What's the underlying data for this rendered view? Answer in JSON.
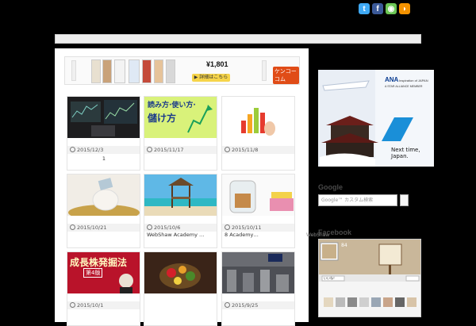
{
  "social": {
    "icons": [
      {
        "name": "twitter-icon",
        "glyph": "t",
        "color": "#3fa9f5"
      },
      {
        "name": "facebook-icon",
        "glyph": "f",
        "color": "#3b5998"
      },
      {
        "name": "feedly-icon",
        "glyph": "◉",
        "color": "#6cc655"
      },
      {
        "name": "rss-icon",
        "glyph": "◗",
        "color": "#f39200"
      }
    ]
  },
  "ad": {
    "price": "¥1,801",
    "button": "▶ 詳細はこちら",
    "logo": "ケンコーコム"
  },
  "posts": [
    {
      "date": "2015/12/3",
      "excerpt": "1"
    },
    {
      "date": "2015/11/17",
      "excerpt": "",
      "thumb_line1": "読み方·使い方·",
      "thumb_line2": "儲け方"
    },
    {
      "date": "2015/11/8",
      "excerpt": ""
    },
    {
      "date": "2015/10/21",
      "excerpt": ""
    },
    {
      "date": "2015/10/6",
      "excerpt": "WebShaw Academy …"
    },
    {
      "date": "2015/10/11",
      "excerpt": "8 Academy…"
    },
    {
      "date": "2015/10/1",
      "excerpt": "",
      "thumb_line1": "成長株発掘法",
      "thumb_line2": "第4版"
    },
    {
      "date": "",
      "excerpt": ""
    },
    {
      "date": "2015/9/25",
      "excerpt": ""
    }
  ],
  "sidebar": {
    "ana_ad": {
      "line1": "ANA",
      "line2": "Inspiration of JAPAN",
      "line3": "A STAR ALLIANCE MEMBER",
      "cta": "Next time, Japan."
    },
    "google_heading": "Google",
    "search_placeholder": "Google™ カスタム検索",
    "stray_text": "WebShaw",
    "facebook_heading": "Facebook",
    "fb_count": "84",
    "fb_like": "いいね！"
  }
}
